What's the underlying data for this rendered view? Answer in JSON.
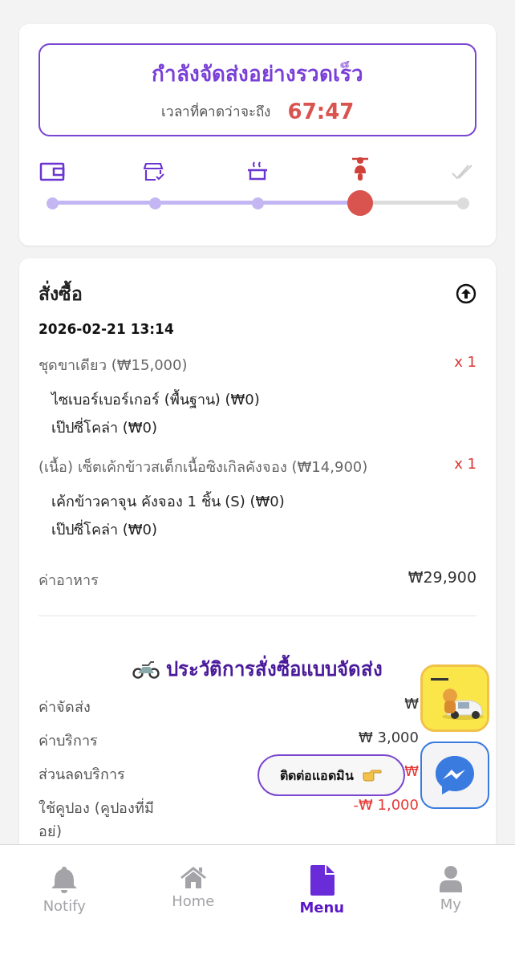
{
  "status": {
    "title": "กำลังจัดส่งอย่างรวดเร็ว",
    "eta_label": "เวลาที่คาดว่าจะถึง",
    "eta": "67:47"
  },
  "steps": [
    {
      "kind": "wallet",
      "done": true,
      "current": false
    },
    {
      "kind": "store",
      "done": true,
      "current": false
    },
    {
      "kind": "pot",
      "done": true,
      "current": false
    },
    {
      "kind": "scooter",
      "done": true,
      "current": true
    },
    {
      "kind": "check",
      "done": false,
      "current": false
    }
  ],
  "order": {
    "title": "สั่งซื้อ",
    "datetime": "2026-02-21 13:14",
    "items": [
      {
        "name": "ชุดขาเดียว (₩15,000)",
        "qty": "x 1",
        "options": [
          "ไซเบอร์เบอร์เกอร์ (พื้นฐาน) (₩0)",
          "เป๊ปซี่โคล่า (₩0)"
        ]
      },
      {
        "name": "(เนื้อ) เซ็ตเค้กข้าวสเต็กเนื้อซิงเกิลคังจอง (₩14,900)",
        "qty": "x 1",
        "options": [
          "เค้กข้าวคาจุน คังจอง 1 ชิ้น (S) (₩0)",
          "เป๊ปซี่โคล่า (₩0)"
        ]
      }
    ],
    "subtotal": {
      "label": "ค่าอาหาร",
      "value": "₩29,900"
    }
  },
  "delivery": {
    "title": "ประวัติการสั่งซื้อแบบจัดส่ง",
    "fees": [
      {
        "label": "ค่าจัดส่ง",
        "value": "₩",
        "kind": "normal"
      },
      {
        "label": "ค่าบริการ",
        "value": "₩ 3,000",
        "kind": "normal"
      },
      {
        "label": "ส่วนลดบริการ",
        "value": "₩",
        "kind": "discount"
      },
      {
        "label": "ใช้คูปอง (คูปองที่มีอย่)",
        "value": "-₩ 1,000",
        "kind": "discount"
      }
    ]
  },
  "contact": {
    "label": "ติดต่อแอดมิน"
  },
  "nav": [
    {
      "label": "Notify",
      "selected": false
    },
    {
      "label": "Home",
      "selected": false
    },
    {
      "label": "Menu",
      "selected": true
    },
    {
      "label": "My",
      "selected": false
    }
  ]
}
